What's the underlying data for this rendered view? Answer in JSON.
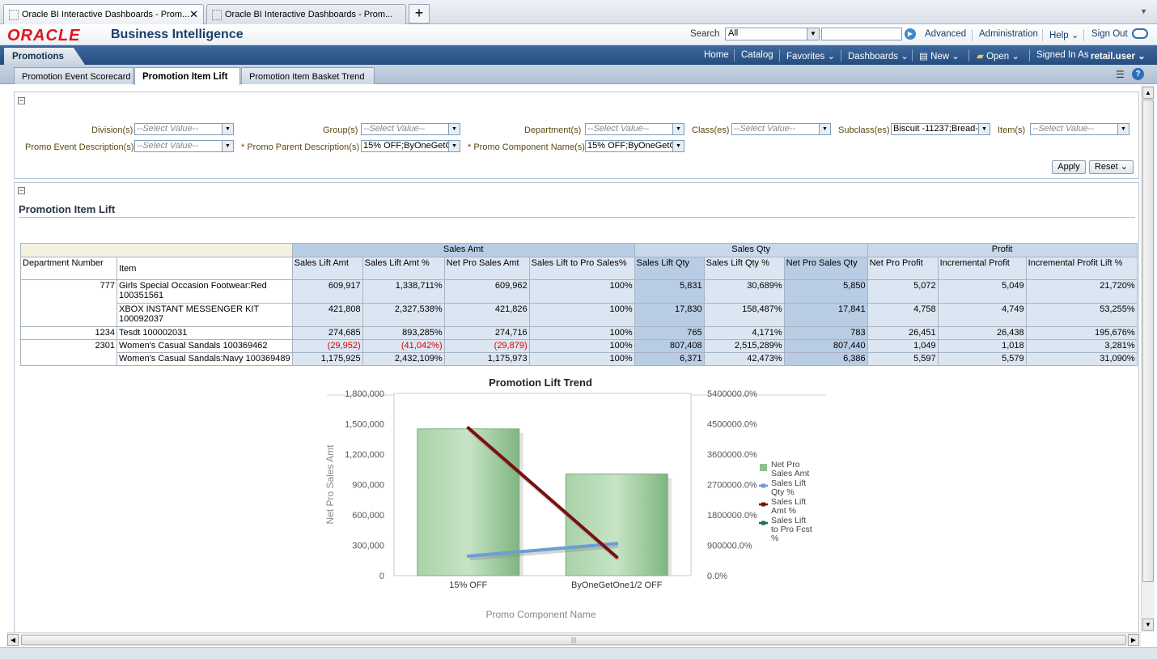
{
  "browser": {
    "tabs": [
      {
        "title": "Oracle BI Interactive Dashboards - Prom..."
      },
      {
        "title": "Oracle BI Interactive Dashboards - Prom..."
      }
    ]
  },
  "header": {
    "logo": "ORACLE",
    "product": "Business Intelligence",
    "search_label": "Search",
    "search_scope": "All",
    "links": [
      "Advanced",
      "Administration",
      "Help",
      "Sign Out"
    ]
  },
  "nav": {
    "dashboard": "Promotions",
    "links": [
      "Home",
      "Catalog",
      "Favorites",
      "Dashboards",
      "New",
      "Open"
    ],
    "signed_in_label": "Signed In As",
    "user": "retail.user"
  },
  "pages": {
    "tabs": [
      "Promotion Event Scorecard",
      "Promotion Item Lift",
      "Promotion Item Basket Trend"
    ],
    "selected": 1
  },
  "prompts": {
    "division": {
      "label": "Division(s)",
      "value": "--Select Value--"
    },
    "group": {
      "label": "Group(s)",
      "value": "--Select Value--"
    },
    "department": {
      "label": "Department(s)",
      "value": "--Select Value--"
    },
    "class": {
      "label": "Class(es)",
      "value": "--Select Value--"
    },
    "subclass": {
      "label": "Subclass(es)",
      "value": "Biscuit -11237;Bread-"
    },
    "item": {
      "label": "Item(s)",
      "value": "--Select Value--"
    },
    "promo_event": {
      "label": "Promo Event Description(s)",
      "value": "--Select Value--"
    },
    "promo_parent": {
      "label": "* Promo Parent Description(s)",
      "value": "15% OFF;ByOneGetO"
    },
    "promo_component": {
      "label": "* Promo Component Name(s)",
      "value": "15% OFF;ByOneGetO"
    },
    "apply": "Apply",
    "reset": "Reset"
  },
  "report": {
    "title": "Promotion Item Lift",
    "groups": [
      "Sales Amt",
      "Sales Qty",
      "Profit"
    ],
    "columns": [
      "Department Number",
      "Item",
      "Sales Lift Amt",
      "Sales Lift Amt %",
      "Net Pro Sales Amt",
      "Sales Lift to Pro Sales%",
      "Sales Lift Qty",
      "Sales Lift Qty %",
      "Net Pro Sales Qty",
      "Net Pro Profit",
      "Incremental Profit",
      "Incremental Profit Lift %"
    ],
    "rows": [
      {
        "dept": "777",
        "item": "Girls Special Occasion Footwear:Red 100351561",
        "vals": [
          "609,917",
          "1,338,711%",
          "609,962",
          "100%",
          "5,831",
          "30,689%",
          "5,850",
          "5,072",
          "5,049",
          "21,720%"
        ]
      },
      {
        "dept": "",
        "item": "XBOX INSTANT MESSENGER KIT 100092037",
        "vals": [
          "421,808",
          "2,327,538%",
          "421,826",
          "100%",
          "17,830",
          "158,487%",
          "17,841",
          "4,758",
          "4,749",
          "53,255%"
        ]
      },
      {
        "dept": "1234",
        "item": "Tesdt 100002031",
        "vals": [
          "274,685",
          "893,285%",
          "274,716",
          "100%",
          "765",
          "4,171%",
          "783",
          "26,451",
          "26,438",
          "195,676%"
        ]
      },
      {
        "dept": "2301",
        "item": "Women's Casual Sandals 100369462",
        "vals": [
          "(29,952)",
          "(41,042%)",
          "(29,879)",
          "100%",
          "807,408",
          "2,515,289%",
          "807,440",
          "1,049",
          "1,018",
          "3,281%"
        ]
      },
      {
        "dept": "",
        "item": "Women's Casual Sandals:Navy 100369489",
        "vals": [
          "1,175,925",
          "2,432,109%",
          "1,175,973",
          "100%",
          "6,371",
          "42,473%",
          "6,386",
          "5,597",
          "5,579",
          "31,090%"
        ]
      }
    ]
  },
  "chart_data": {
    "type": "bar",
    "title": "Promotion Lift Trend",
    "xlabel": "Promo Component Name",
    "ylabel": "Net Pro Sales Amt",
    "categories": [
      "15% OFF",
      "ByOneGetOne1/2 OFF"
    ],
    "ylim": [
      0,
      1800000
    ],
    "y_ticks": [
      "0",
      "300,000",
      "600,000",
      "900,000",
      "1,200,000",
      "1,500,000",
      "1,800,000"
    ],
    "y2lim": [
      0,
      5400000
    ],
    "y2_ticks": [
      "0.0%",
      "900000.0%",
      "1800000.0%",
      "2700000.0%",
      "3600000.0%",
      "4500000.0%",
      "5400000.0%"
    ],
    "series": [
      {
        "name": "Net Pro Sales Amt",
        "kind": "bar",
        "axis": "left",
        "color": "#8cc08c",
        "values": [
          1450000,
          1005000
        ]
      },
      {
        "name": "Sales Lift Qty %",
        "kind": "line",
        "axis": "right",
        "color": "#6a9fd4",
        "values": [
          580000,
          950000
        ]
      },
      {
        "name": "Sales Lift Amt %",
        "kind": "line",
        "axis": "right",
        "color": "#7a0f0f",
        "values": [
          4380000,
          550000
        ]
      },
      {
        "name": "Sales Lift to Pro Fcst %",
        "kind": "line",
        "axis": "right",
        "color": "#1f6b5a",
        "values": []
      }
    ],
    "legend": "right"
  }
}
